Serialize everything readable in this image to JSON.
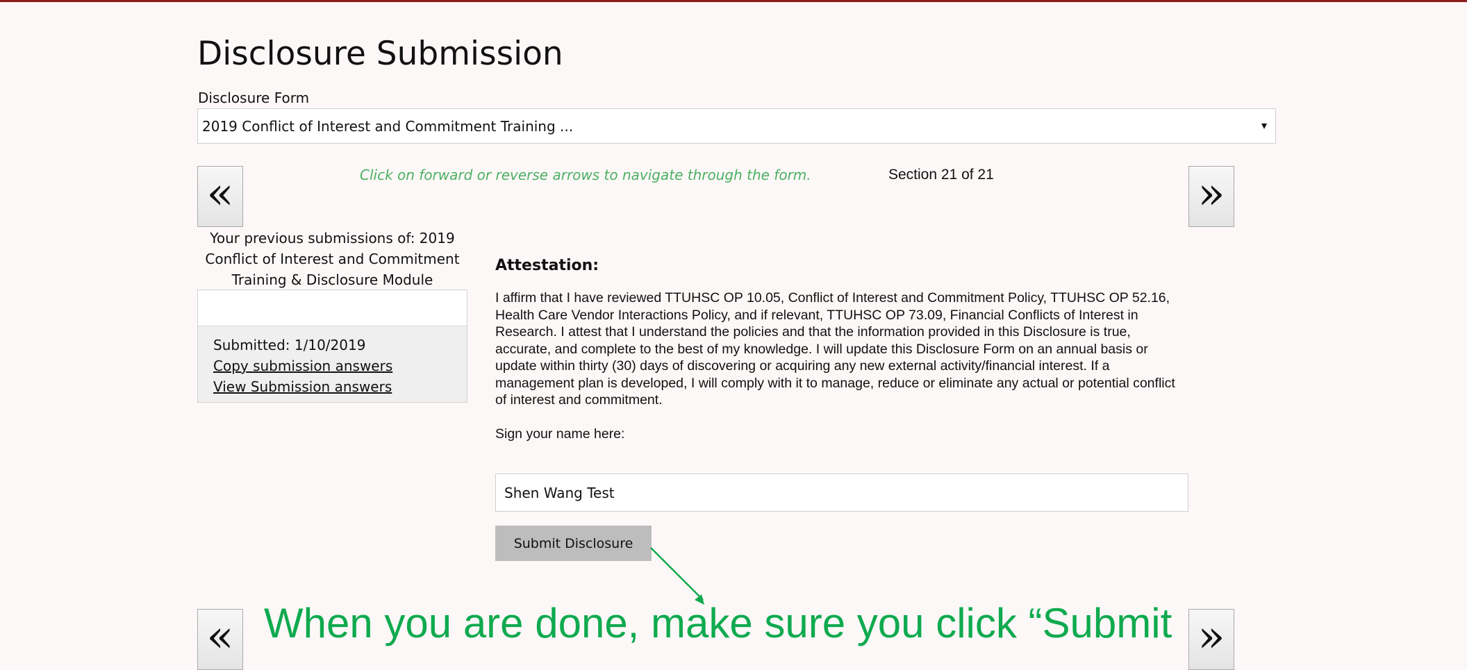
{
  "page": {
    "title": "Disclosure Submission"
  },
  "form_select": {
    "label": "Disclosure Form",
    "selected": "2019 Conflict of Interest and Commitment Training ...",
    "caret": "▾"
  },
  "navigation": {
    "prev_glyph": "«",
    "next_glyph": "»",
    "hint": "Click on forward or reverse arrows to navigate through the form.",
    "section_counter": "Section 21 of 21"
  },
  "previous_submissions": {
    "heading": "Your previous submissions of: 2019 Conflict of Interest and Commitment Training & Disclosure Module",
    "submitted": "Submitted: 1/10/2019",
    "copy_link": "Copy submission answers",
    "view_link": "View Submission answers"
  },
  "attestation": {
    "title": "Attestation:",
    "body": "I affirm that I have reviewed TTUHSC OP 10.05, Conflict of Interest and Commitment Policy, TTUHSC OP 52.16, Health Care Vendor Interactions Policy, and if relevant, TTUHSC OP 73.09, Financial Conflicts of Interest in Research. I attest that I understand the policies and that the information provided in this Disclosure is true, accurate, and complete to the best of my knowledge. I will update this Disclosure Form on an annual basis or update within thirty (30) days of discovering or acquiring any new external activity/financial interest. If a management plan is developed, I will comply with it to manage, reduce or eliminate any actual or potential conflict of interest and commitment.",
    "sign_label": "Sign your name here:",
    "signature_value": "Shen Wang Test",
    "submit_label": "Submit Disclosure"
  },
  "annotation": {
    "callout": "When you are done, make sure you click “Submit",
    "color": "#0faa4f"
  },
  "colors": {
    "top_rule": "#8e1b1b",
    "hint_green": "#4caf63",
    "submit_bg": "#bdbdbd"
  }
}
